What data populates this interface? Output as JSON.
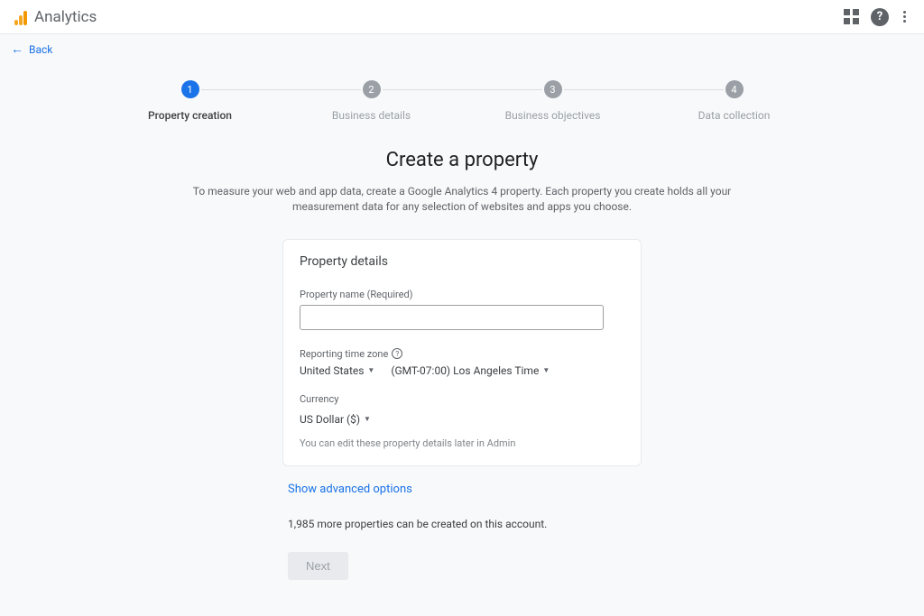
{
  "header": {
    "app_title": "Analytics",
    "back_label": "Back"
  },
  "stepper": {
    "steps": [
      {
        "num": "1",
        "label": "Property creation",
        "active": true
      },
      {
        "num": "2",
        "label": "Business details",
        "active": false
      },
      {
        "num": "3",
        "label": "Business objectives",
        "active": false
      },
      {
        "num": "4",
        "label": "Data collection",
        "active": false
      }
    ]
  },
  "main": {
    "title": "Create a property",
    "subtitle": "To measure your web and app data, create a Google Analytics 4 property. Each property you create holds all your measurement data for any selection of websites and apps you choose."
  },
  "card": {
    "title": "Property details",
    "property_name_label": "Property name (Required)",
    "property_name_value": "",
    "tz_label": "Reporting time zone",
    "tz_country": "United States",
    "tz_value": "(GMT-07:00) Los Angeles Time",
    "currency_label": "Currency",
    "currency_value": "US Dollar ($)",
    "edit_note": "You can edit these property details later in Admin"
  },
  "footer": {
    "advanced_link": "Show advanced options",
    "properties_note": "1,985 more properties can be created on this account.",
    "next_button": "Next"
  }
}
